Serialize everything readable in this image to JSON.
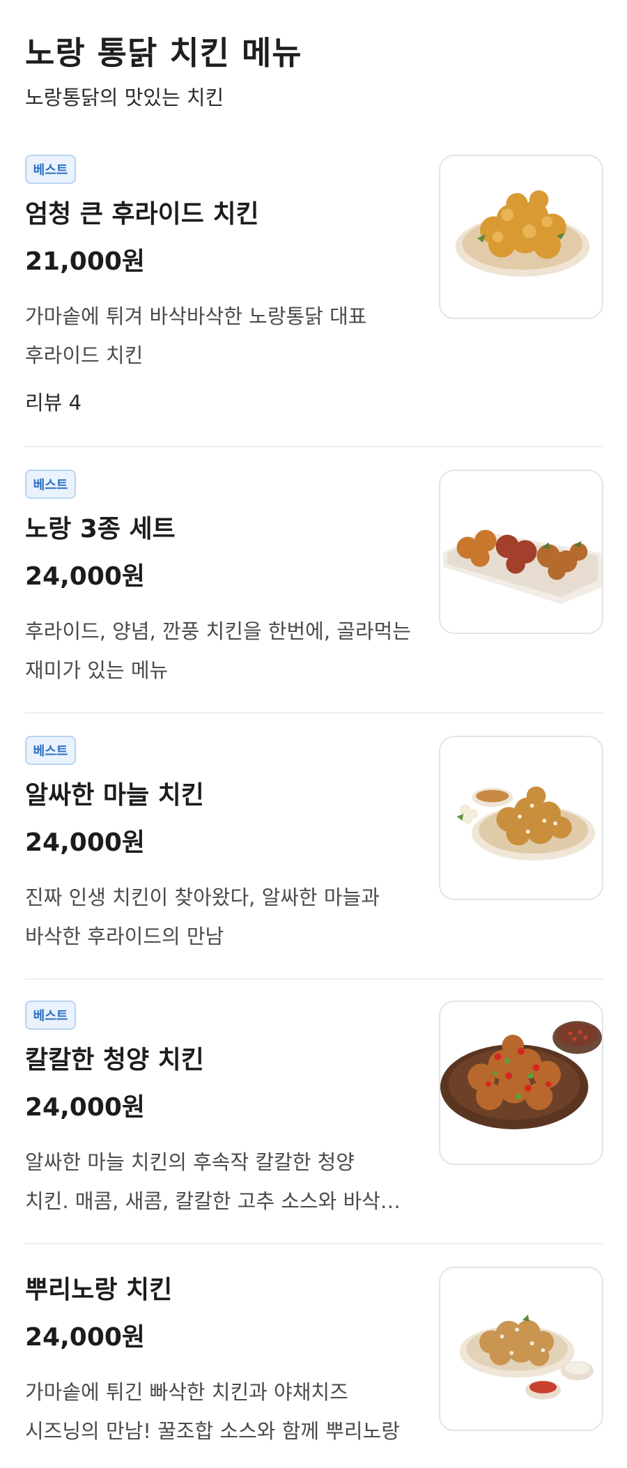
{
  "header": {
    "title": "노랑 통닭 치킨 메뉴",
    "subtitle": "노랑통닭의 맛있는 치킨"
  },
  "menu": [
    {
      "badge": "베스트",
      "name": "엄청 큰 후라이드 치킨",
      "price": "21,000원",
      "desc_line1": "가마솥에 튀겨 바삭바삭한 노랑통닭 대표",
      "desc_line2": "후라이드 치킨",
      "review": "리뷰 4",
      "image_icon": "fried-chicken-plate"
    },
    {
      "badge": "베스트",
      "name": "노랑 3종 세트",
      "price": "24,000원",
      "desc_line1": "후라이드, 양념, 깐풍 치킨을 한번에, 골라먹는",
      "desc_line2": "재미가 있는 메뉴",
      "image_icon": "three-chicken-platter"
    },
    {
      "badge": "베스트",
      "name": "알싸한 마늘 치킨",
      "price": "24,000원",
      "desc_line1": "진짜 인생 치킨이 찾아왔다, 알싸한 마늘과",
      "desc_line2": "바삭한 후라이드의 만남",
      "image_icon": "garlic-chicken-plate"
    },
    {
      "badge": "베스트",
      "name": "칼칼한 청양 치킨",
      "price": "24,000원",
      "desc_line1": "알싸한 마늘 치킨의 후속작 칼칼한 청양",
      "desc_line2": "치킨. 매콤, 새콤, 칼칼한 고추 소스와 바삭…",
      "image_icon": "spicy-chicken-plate"
    },
    {
      "name": "뿌리노랑 치킨",
      "price": "24,000원",
      "desc_line1": "가마솥에 튀긴 빠삭한 치킨과 야채치즈",
      "desc_line2": "시즈닝의 만남! 꿀조합 소스와 함께 뿌리노랑",
      "image_icon": "seasoned-chicken-plate"
    }
  ],
  "colors": {
    "badge_bg": "#e9f2fd",
    "badge_border": "#b9d4f2",
    "badge_text": "#2d6fc1",
    "divider": "#efefef"
  }
}
